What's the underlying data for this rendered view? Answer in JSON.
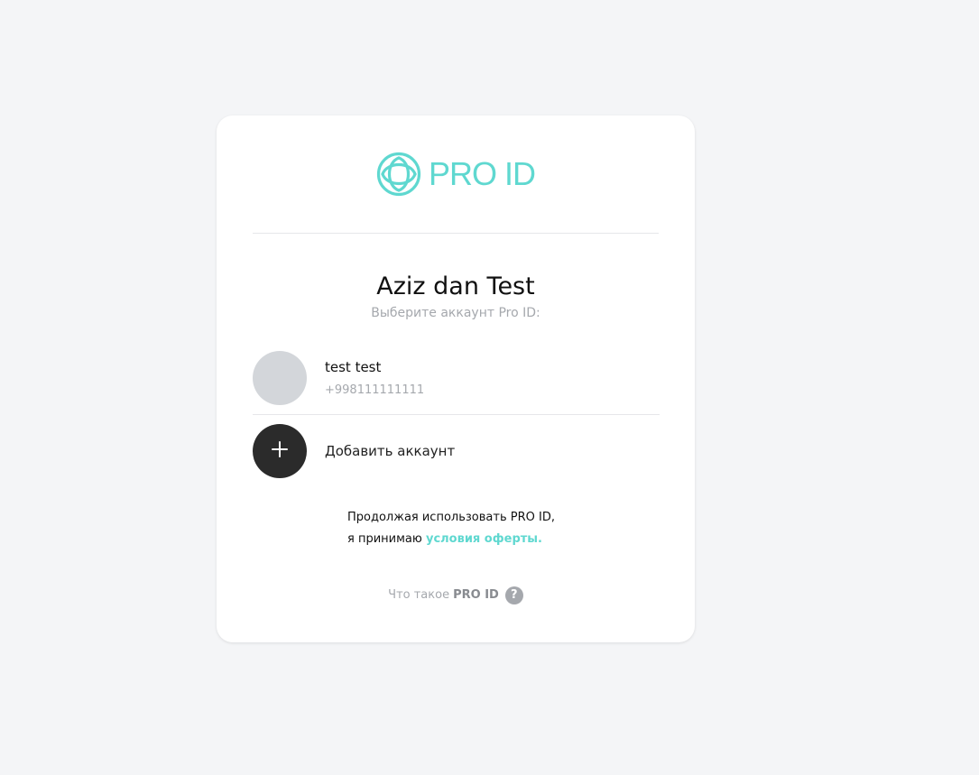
{
  "brand": {
    "logo_text": "PRO ID",
    "accent_color": "#5fd8d0",
    "logo_icon": "globe-icon"
  },
  "header": {
    "title": "Aziz dan Test",
    "subtitle": "Выберите аккаунт Pro ID:"
  },
  "accounts": [
    {
      "name": "test test",
      "phone": "+998111111111",
      "avatar_icon": "avatar-placeholder"
    }
  ],
  "add_account": {
    "label": "Добавить аккаунт",
    "icon": "plus-icon"
  },
  "terms": {
    "line1": "Продолжая использовать PRO ID,",
    "line2_prefix": "я принимаю",
    "link_text": "условия оферты."
  },
  "footer": {
    "what_is_prefix": "Что такое",
    "what_is_brand": "PRO ID",
    "help_icon": "question-icon",
    "help_symbol": "?"
  }
}
